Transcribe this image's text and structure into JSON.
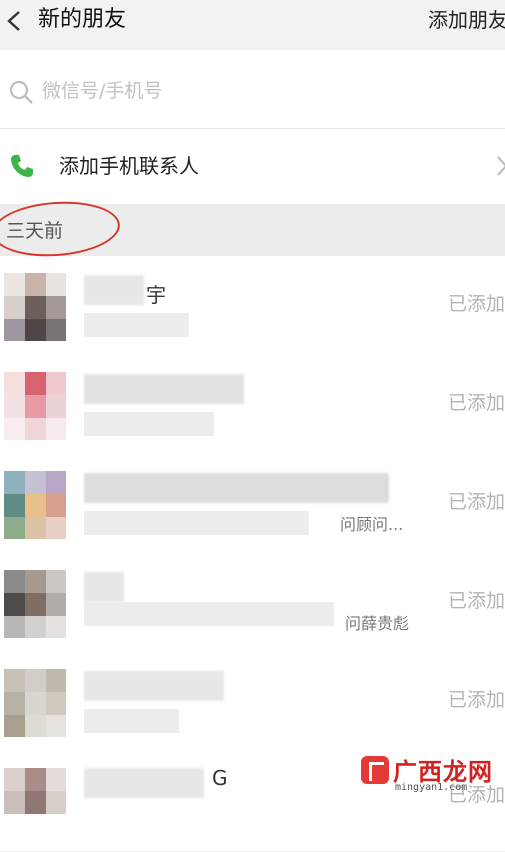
{
  "header": {
    "title": "新的朋友",
    "add_friends_label": "添加朋友"
  },
  "search": {
    "placeholder": "微信号/手机号"
  },
  "phone_contacts": {
    "label": "添加手机联系人"
  },
  "section": {
    "label": "三天前"
  },
  "friend_requests": [
    {
      "name_fragment": "宇",
      "subtitle_fragment": "",
      "status": "已添加"
    },
    {
      "name_fragment": "",
      "subtitle_fragment": "",
      "status": "已添加"
    },
    {
      "name_fragment": "",
      "subtitle_fragment": "问顾问...",
      "status": "已添加"
    },
    {
      "name_fragment": "",
      "subtitle_fragment": "问薛贵彪",
      "status": "已添加"
    },
    {
      "name_fragment": "",
      "subtitle_fragment": "",
      "status": "已添加"
    },
    {
      "name_fragment": "G",
      "subtitle_fragment": "",
      "status": "已添加"
    }
  ],
  "watermark": {
    "text": "广西龙网",
    "url": "mingyan1.com"
  },
  "colors": {
    "accent_green": "#3bb54a",
    "annotation_red": "#d9342b"
  }
}
